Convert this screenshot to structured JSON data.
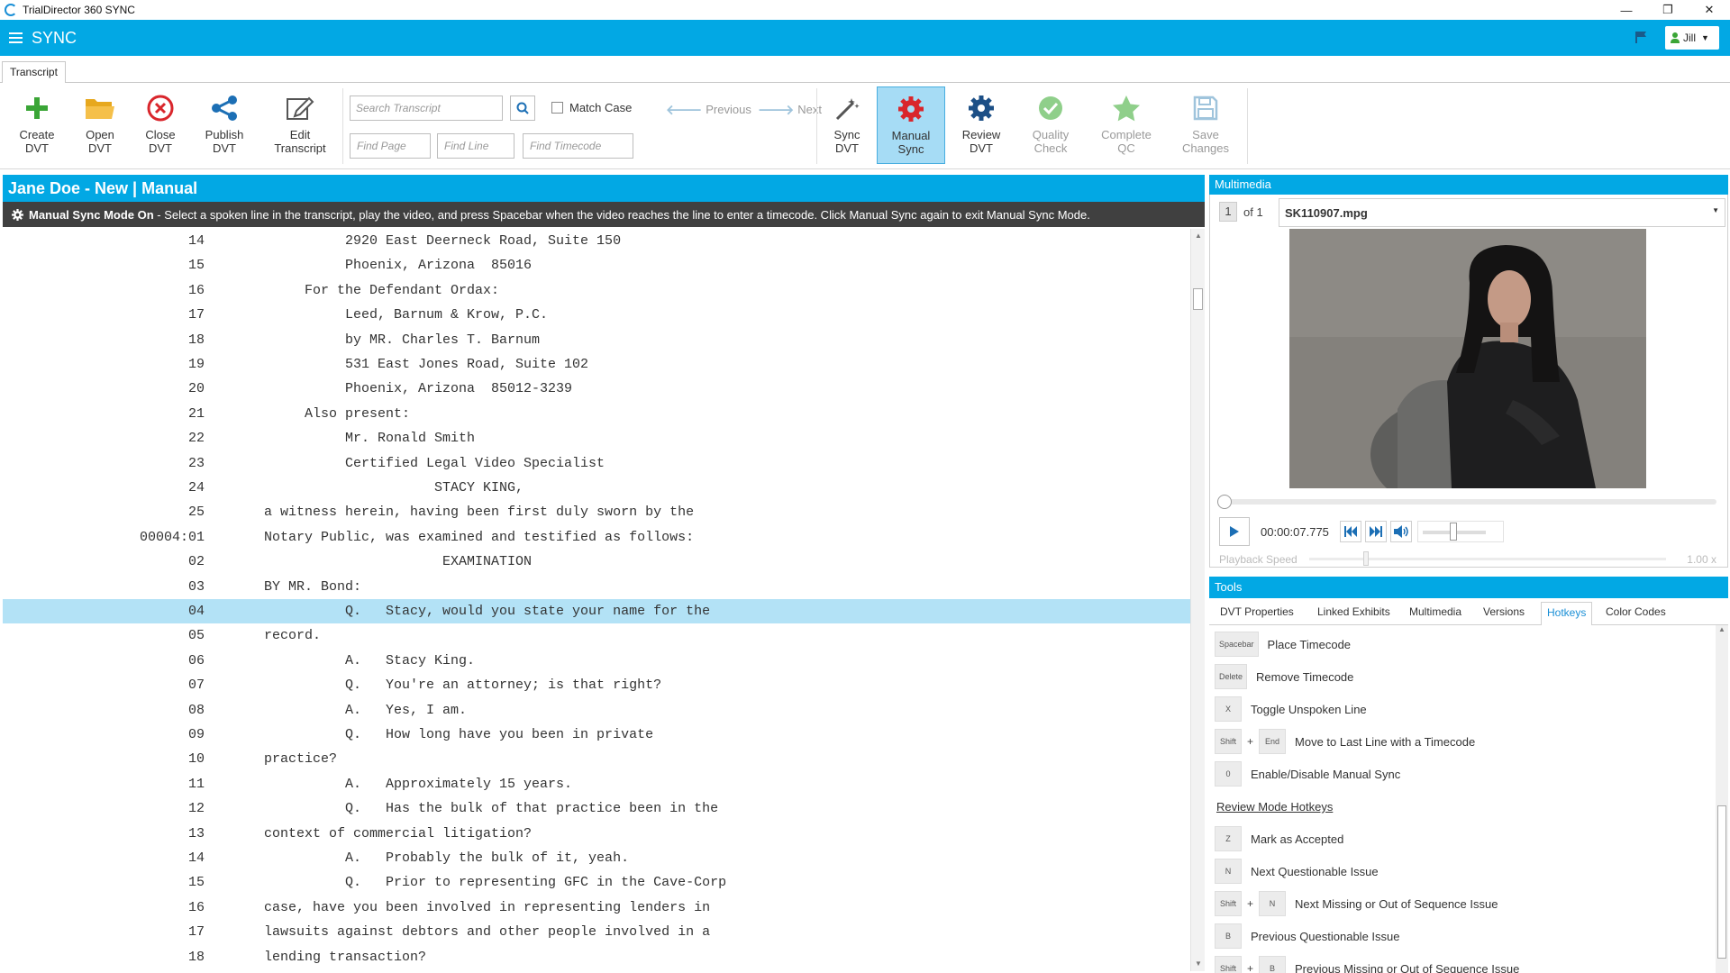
{
  "window": {
    "title": "TrialDirector 360 SYNC",
    "minimize": "—",
    "restore": "❐",
    "close": "✕"
  },
  "appbar": {
    "app_name": "SYNC",
    "user": "Jill"
  },
  "ribbon": {
    "tab": "Transcript",
    "buttons": [
      {
        "line1": "Create",
        "line2": "DVT",
        "icon": "plus-icon"
      },
      {
        "line1": "Open",
        "line2": "DVT",
        "icon": "folder-icon"
      },
      {
        "line1": "Close",
        "line2": "DVT",
        "icon": "close-circle-icon"
      },
      {
        "line1": "Publish",
        "line2": "DVT",
        "icon": "share-icon"
      },
      {
        "line1": "Edit",
        "line2": "Transcript",
        "icon": "edit-icon"
      },
      {
        "line1": "Sync",
        "line2": "DVT",
        "icon": "magic-wand-icon"
      },
      {
        "line1": "Manual",
        "line2": "Sync",
        "icon": "gear-icon"
      },
      {
        "line1": "Review",
        "line2": "DVT",
        "icon": "gear-icon"
      },
      {
        "line1": "Quality",
        "line2": "Check",
        "icon": "check-circle-icon"
      },
      {
        "line1": "Complete",
        "line2": "QC",
        "icon": "star-icon"
      },
      {
        "line1": "Save",
        "line2": "Changes",
        "icon": "save-icon"
      }
    ],
    "search_placeholder": "Search Transcript",
    "match_case": "Match Case",
    "previous": "Previous",
    "next": "Next",
    "find_page": "Find Page",
    "find_line": "Find Line",
    "find_timecode": "Find Timecode"
  },
  "document": {
    "title": "Jane Doe - New | Manual",
    "banner_bold": "Manual Sync Mode On",
    "banner_text": " - Select a spoken line in the transcript, play the video, and press Spacebar when the video reaches the line to enter a timecode. Click Manual Sync again to exit Manual Sync Mode."
  },
  "transcript": [
    {
      "ln": "14",
      "text": "          2920 East Deerneck Road, Suite 150"
    },
    {
      "ln": "15",
      "text": "          Phoenix, Arizona  85016"
    },
    {
      "ln": "16",
      "text": "     For the Defendant Ordax:"
    },
    {
      "ln": "17",
      "text": "          Leed, Barnum & Krow, P.C."
    },
    {
      "ln": "18",
      "text": "          by MR. Charles T. Barnum"
    },
    {
      "ln": "19",
      "text": "          531 East Jones Road, Suite 102"
    },
    {
      "ln": "20",
      "text": "          Phoenix, Arizona  85012-3239"
    },
    {
      "ln": "21",
      "text": "     Also present:"
    },
    {
      "ln": "22",
      "text": "          Mr. Ronald Smith"
    },
    {
      "ln": "23",
      "text": "          Certified Legal Video Specialist"
    },
    {
      "ln": "24",
      "text": "                     STACY KING,"
    },
    {
      "ln": "25",
      "text": "a witness herein, having been first duly sworn by the"
    },
    {
      "ln": "00004:01",
      "text": "Notary Public, was examined and testified as follows:"
    },
    {
      "ln": "02",
      "text": "                      EXAMINATION"
    },
    {
      "ln": "03",
      "text": "BY MR. Bond:"
    },
    {
      "ln": "04",
      "text": "          Q.   Stacy, would you state your name for the"
    },
    {
      "ln": "05",
      "text": "record."
    },
    {
      "ln": "06",
      "text": "          A.   Stacy King."
    },
    {
      "ln": "07",
      "text": "          Q.   You're an attorney; is that right?"
    },
    {
      "ln": "08",
      "text": "          A.   Yes, I am."
    },
    {
      "ln": "09",
      "text": "          Q.   How long have you been in private"
    },
    {
      "ln": "10",
      "text": "practice?"
    },
    {
      "ln": "11",
      "text": "          A.   Approximately 15 years."
    },
    {
      "ln": "12",
      "text": "          Q.   Has the bulk of that practice been in the"
    },
    {
      "ln": "13",
      "text": "context of commercial litigation?"
    },
    {
      "ln": "14",
      "text": "          A.   Probably the bulk of it, yeah."
    },
    {
      "ln": "15",
      "text": "          Q.   Prior to representing GFC in the Cave-Corp"
    },
    {
      "ln": "16",
      "text": "case, have you been involved in representing lenders in"
    },
    {
      "ln": "17",
      "text": "lawsuits against debtors and other people involved in a"
    },
    {
      "ln": "18",
      "text": "lending transaction?"
    }
  ],
  "highlighted_line": "04",
  "multimedia": {
    "header": "Multimedia",
    "page_current": "1",
    "page_of": "of 1",
    "file": "SK110907.mpg",
    "timecode": "00:00:07.775",
    "playback_label": "Playback Speed",
    "playback_value": "1.00 x",
    "playback_progress": 0.01
  },
  "tools": {
    "header": "Tools",
    "tabs": [
      "DVT Properties",
      "Linked Exhibits",
      "Multimedia",
      "Versions",
      "Hotkeys",
      "Color Codes"
    ],
    "active_tab": "Hotkeys",
    "hotkeys": [
      {
        "keys": [
          "Spacebar"
        ],
        "label": "Place Timecode"
      },
      {
        "keys": [
          "Delete"
        ],
        "label": "Remove Timecode"
      },
      {
        "keys": [
          "X"
        ],
        "label": "Toggle Unspoken Line"
      },
      {
        "keys": [
          "Shift",
          "End"
        ],
        "label": "Move to Last Line with a Timecode"
      },
      {
        "keys": [
          "0"
        ],
        "label": "Enable/Disable Manual Sync"
      }
    ],
    "review_section": "Review Mode Hotkeys",
    "review_hotkeys": [
      {
        "keys": [
          "Z"
        ],
        "label": "Mark as Accepted"
      },
      {
        "keys": [
          "N"
        ],
        "label": "Next Questionable Issue"
      },
      {
        "keys": [
          "Shift",
          "N"
        ],
        "label": "Next Missing or Out of Sequence Issue"
      },
      {
        "keys": [
          "B"
        ],
        "label": "Previous Questionable Issue"
      },
      {
        "keys": [
          "Shift",
          "B"
        ],
        "label": "Previous Missing or Out of Sequence Issue"
      }
    ]
  },
  "colors": {
    "accent": "#02a8e4",
    "banner": "#404040",
    "highlight": "#b3e2f6",
    "active_button": "#a6dcf5"
  }
}
